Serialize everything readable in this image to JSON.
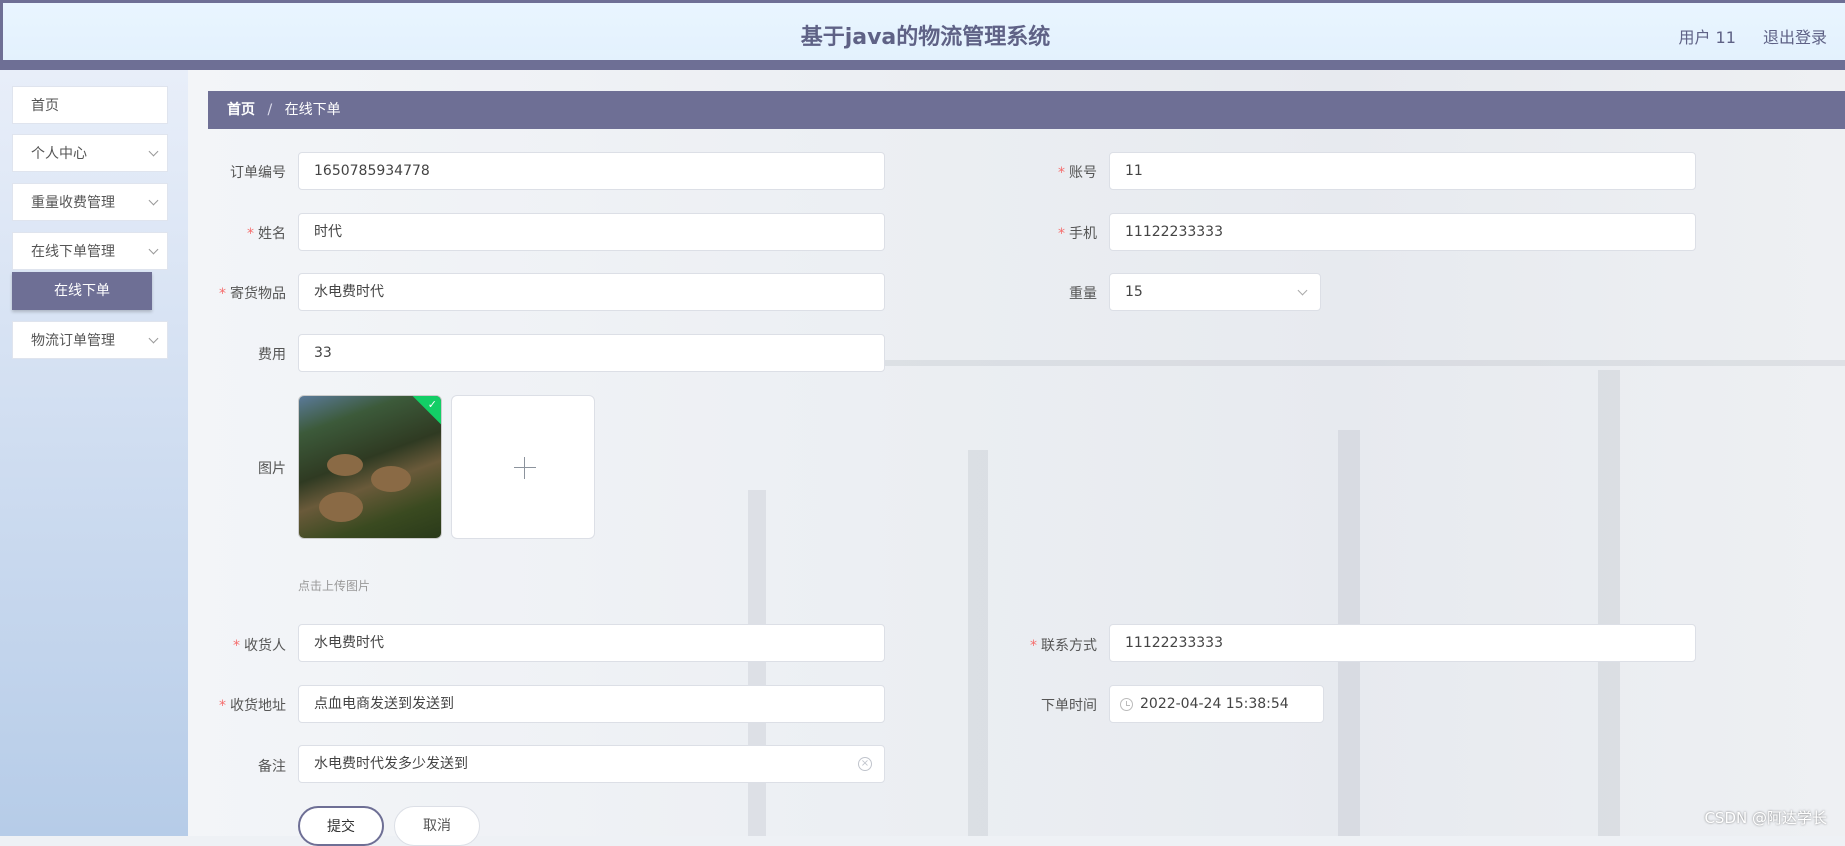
{
  "header": {
    "title": "基于java的物流管理系统",
    "user_label": "用户 11",
    "logout_label": "退出登录"
  },
  "sidebar": {
    "items": [
      {
        "label": "首页"
      },
      {
        "label": "个人中心"
      },
      {
        "label": "重量收费管理"
      },
      {
        "label": "在线下单管理"
      },
      {
        "label": "物流订单管理"
      }
    ],
    "active_sub": "在线下单"
  },
  "breadcrumb": {
    "home": "首页",
    "separator": "/",
    "current": "在线下单"
  },
  "form": {
    "order_no": {
      "label": "订单编号",
      "value": "1650785934778"
    },
    "account": {
      "label": "账号",
      "value": "11"
    },
    "name": {
      "label": "姓名",
      "value": "时代"
    },
    "phone": {
      "label": "手机",
      "value": "11122233333"
    },
    "goods": {
      "label": "寄货物品",
      "value": "水电费时代"
    },
    "weight": {
      "label": "重量",
      "value": "15"
    },
    "fee": {
      "label": "费用",
      "value": "33"
    },
    "image": {
      "label": "图片",
      "hint": "点击上传图片"
    },
    "receiver": {
      "label": "收货人",
      "value": "水电费时代"
    },
    "contact": {
      "label": "联系方式",
      "value": "11122233333"
    },
    "address": {
      "label": "收货地址",
      "value": "点血电商发送到发送到"
    },
    "order_time": {
      "label": "下单时间",
      "value": "2022-04-24 15:38:54"
    },
    "remark": {
      "label": "备注",
      "value": "水电费时代发多少发送到"
    },
    "submit_label": "提交",
    "cancel_label": "取消",
    "required_mark": "*"
  },
  "icons": {
    "chevron": "chevron-down-icon",
    "plus": "plus-icon",
    "clock": "clock-icon",
    "clear": "clear-icon",
    "check": "check-icon"
  },
  "colors": {
    "accent": "#6e6f95",
    "success": "#13ce66",
    "required": "#f56c6c"
  },
  "watermark": "CSDN @阿达学长"
}
